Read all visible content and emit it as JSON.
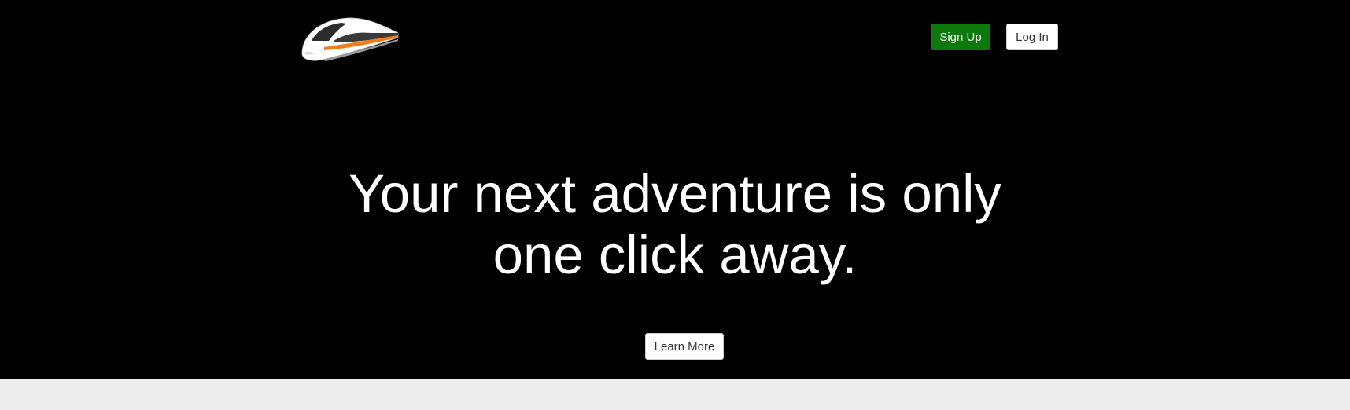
{
  "header": {
    "logo_icon": "bullet-train-icon",
    "signup_label": "Sign Up",
    "login_label": "Log In"
  },
  "hero": {
    "headline_line1": "Your next adventure is only",
    "headline_line2": "one click away.",
    "learn_more_label": "Learn More"
  },
  "colors": {
    "hero_background": "#000000",
    "page_background": "#ededed",
    "signup_button": "#0b7a0b",
    "train_stripe": "#f07d1a"
  }
}
